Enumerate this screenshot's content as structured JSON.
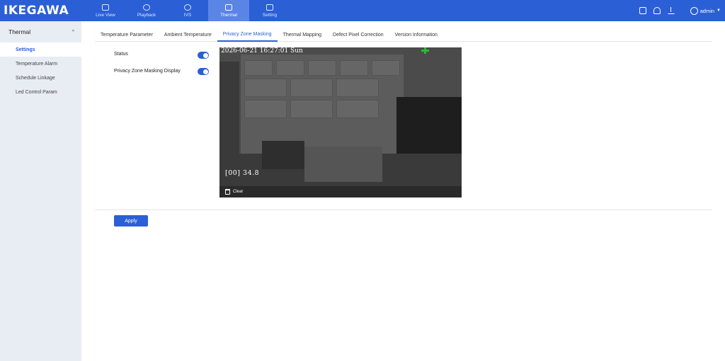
{
  "brand": {
    "logo": "IKEGAWA"
  },
  "nav": [
    {
      "label": "Live View",
      "icon": "live-view-icon"
    },
    {
      "label": "Playback",
      "icon": "playback-icon"
    },
    {
      "label": "IVS",
      "icon": "ivs-icon"
    },
    {
      "label": "Thermal",
      "icon": "thermal-icon"
    },
    {
      "label": "Setting",
      "icon": "setting-icon"
    }
  ],
  "nav_active": "Thermal",
  "user": {
    "name": "admin"
  },
  "sidebar": {
    "section": "Thermal",
    "items": [
      {
        "label": "Settings"
      },
      {
        "label": "Temperature Alarm"
      },
      {
        "label": "Schedule Linkage"
      },
      {
        "label": "Led Control Param"
      }
    ],
    "active": "Settings"
  },
  "tabs": [
    {
      "label": "Temperature Parameter"
    },
    {
      "label": "Ambient Temperature"
    },
    {
      "label": "Privacy Zone Masking"
    },
    {
      "label": "Thermal Mapping"
    },
    {
      "label": "Defect Pixel Correction"
    },
    {
      "label": "Version Information"
    }
  ],
  "tab_active": "Privacy Zone Masking",
  "form": {
    "status_label": "Status",
    "status_on": true,
    "display_label": "Privacy Zone Masking Display",
    "display_on": true
  },
  "video": {
    "timestamp": "2026-06-21 16:27:01 Sun",
    "temperature": "[00] 34.8",
    "clear_label": "Clear"
  },
  "actions": {
    "apply_label": "Apply"
  },
  "colors": {
    "accent": "#2b5fd6",
    "topbar": "#2b5fd6",
    "sidebar": "#e8ecf3",
    "crosshair": "#24c030"
  }
}
